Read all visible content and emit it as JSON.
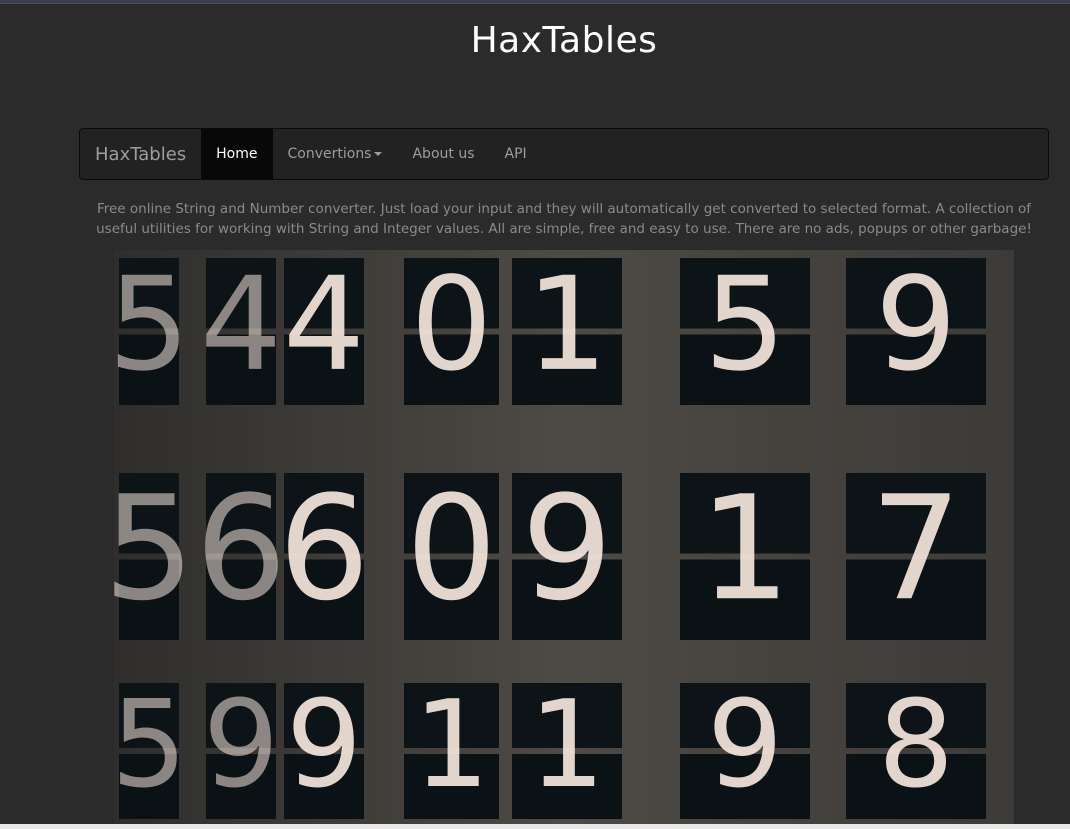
{
  "site": {
    "title": "HaxTables"
  },
  "navbar": {
    "brand": "HaxTables",
    "items": [
      {
        "label": "Home",
        "active": true
      },
      {
        "label": "Convertions",
        "dropdown": true
      },
      {
        "label": "About us"
      },
      {
        "label": "API"
      }
    ]
  },
  "intro": {
    "text": "Free online String and Number converter. Just load your input and they will automatically get converted to selected format. A collection of useful utilities for working with String and Integer values. All are simple, free and easy to use. There are no ads, popups or other garbage!"
  },
  "hero": {
    "digits": [
      "5",
      "4",
      "4",
      "0",
      "1",
      "5",
      "9",
      "5",
      "6",
      "6",
      "0",
      "9",
      "1",
      "7",
      "5",
      "9",
      "9",
      "1",
      "1",
      "9",
      "8"
    ]
  },
  "colors": {
    "background": "#2b2b2b",
    "navbar": "#222222",
    "active_nav": "#080808",
    "digit_glow": "#f5e6dc"
  }
}
